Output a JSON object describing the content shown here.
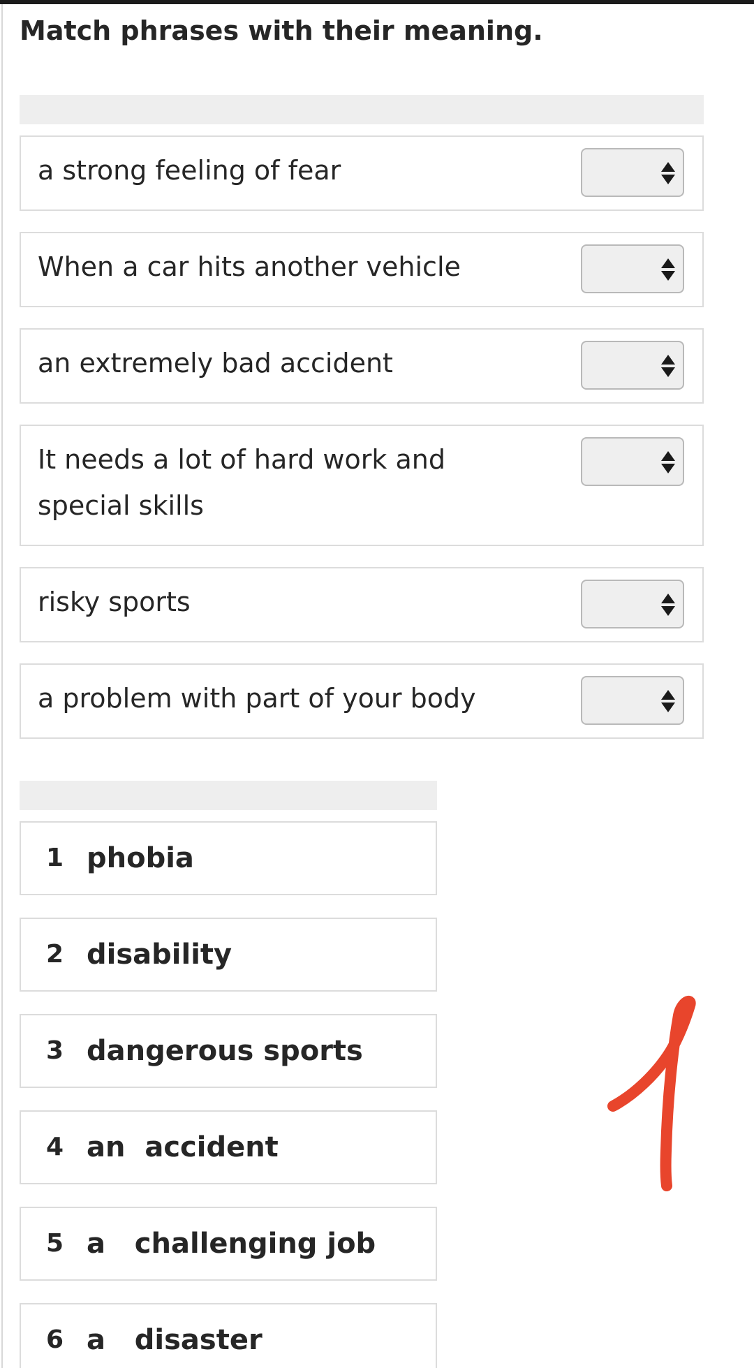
{
  "instruction": "Match phrases with their meaning.",
  "definitions": [
    {
      "text": "a strong feeling of fear",
      "selected": ""
    },
    {
      "text": "When a car hits another vehicle",
      "selected": ""
    },
    {
      "text": "an extremely bad accident",
      "selected": ""
    },
    {
      "text": "It needs a lot of hard work and special skills",
      "selected": ""
    },
    {
      "text": "risky sports",
      "selected": ""
    },
    {
      "text": "a problem with part of your body",
      "selected": ""
    }
  ],
  "terms": [
    {
      "number": "1",
      "text": "phobia"
    },
    {
      "number": "2",
      "text": "disability"
    },
    {
      "number": "3",
      "text": "dangerous sports"
    },
    {
      "number": "4",
      "text": "an  accident"
    },
    {
      "number": "5",
      "text": "a   challenging job"
    },
    {
      "number": "6",
      "text": "a   disaster"
    }
  ],
  "colors": {
    "text": "#262626",
    "header_strip": "#eeeeee",
    "row_border": "#dcdcdc",
    "select_bg": "#efefef",
    "handwriting": "#e8452c"
  },
  "icons": {
    "select_arrows": "up-down-arrows-icon"
  }
}
